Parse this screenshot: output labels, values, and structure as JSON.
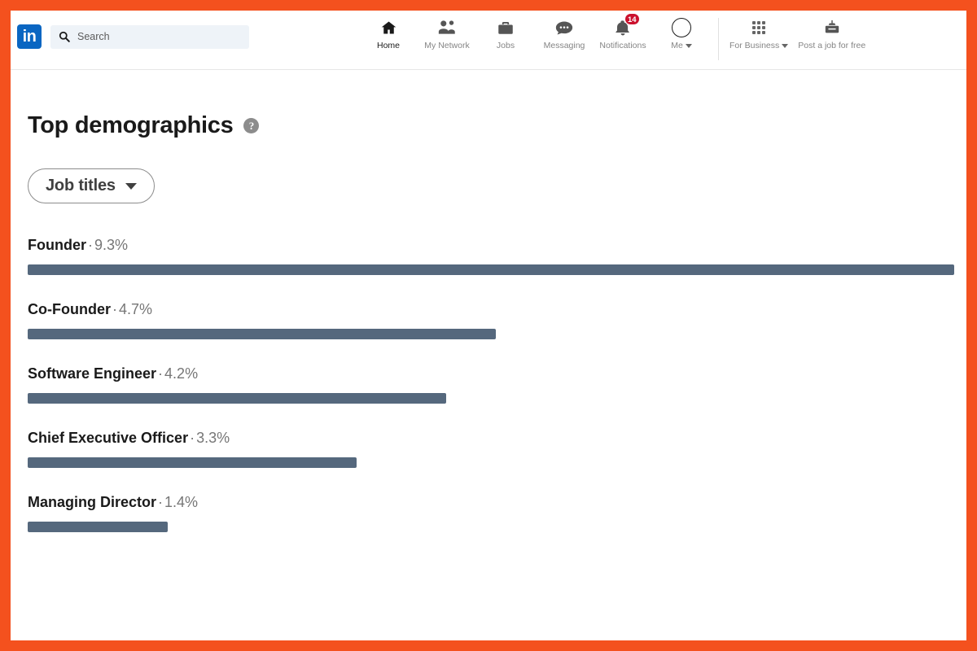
{
  "theme": {
    "frame_color": "#f4511e",
    "brand_color": "#0a66c2",
    "bar_color": "#55687d",
    "badge_color": "#cb112d"
  },
  "navbar": {
    "logo_text": "in",
    "search": {
      "placeholder": "Search",
      "value": "",
      "icon": "search-icon"
    },
    "items": [
      {
        "label": "Home",
        "icon": "home-icon",
        "active": true,
        "badge": ""
      },
      {
        "label": "My Network",
        "icon": "people-icon",
        "active": false,
        "badge": ""
      },
      {
        "label": "Jobs",
        "icon": "briefcase-icon",
        "active": false,
        "badge": ""
      },
      {
        "label": "Messaging",
        "icon": "message-bubble-icon",
        "active": false,
        "badge": ""
      },
      {
        "label": "Notifications",
        "icon": "bell-icon",
        "active": false,
        "badge": "14"
      }
    ],
    "me": {
      "label": "Me",
      "icon": "avatar-icon",
      "caret": "chevron-down-icon"
    },
    "business": {
      "label": "For Business",
      "icon": "grid-apps-icon",
      "caret": "chevron-down-icon"
    },
    "post_job": {
      "label": "Post a job for free",
      "icon": "post-job-icon"
    }
  },
  "main": {
    "title": "Top demographics",
    "help_icon": "question-mark-icon",
    "help_glyph": "?",
    "filter": {
      "label": "Job titles",
      "caret": "chevron-down-icon"
    }
  },
  "chart_data": {
    "type": "bar",
    "title": "Top demographics",
    "xlabel": "",
    "ylabel": "",
    "orientation": "horizontal",
    "unit": "%",
    "separator": "·",
    "max_value": 9.3,
    "categories": [
      "Founder",
      "Co-Founder",
      "Software Engineer",
      "Chief Executive Officer",
      "Managing Director"
    ],
    "values": [
      9.3,
      4.7,
      4.2,
      3.3,
      1.4
    ],
    "value_labels": [
      "9.3%",
      "4.7%",
      "4.2%",
      "3.3%",
      "1.4%"
    ],
    "rows": [
      {
        "name": "Founder",
        "value": 9.3,
        "value_label": "9.3%",
        "bar_pct": 100.0
      },
      {
        "name": "Co-Founder",
        "value": 4.7,
        "value_label": "4.7%",
        "bar_pct": 50.5
      },
      {
        "name": "Software Engineer",
        "value": 4.2,
        "value_label": "4.2%",
        "bar_pct": 45.2
      },
      {
        "name": "Chief Executive Officer",
        "value": 3.3,
        "value_label": "3.3%",
        "bar_pct": 35.5
      },
      {
        "name": "Managing Director",
        "value": 1.4,
        "value_label": "1.4%",
        "bar_pct": 15.1
      }
    ]
  }
}
